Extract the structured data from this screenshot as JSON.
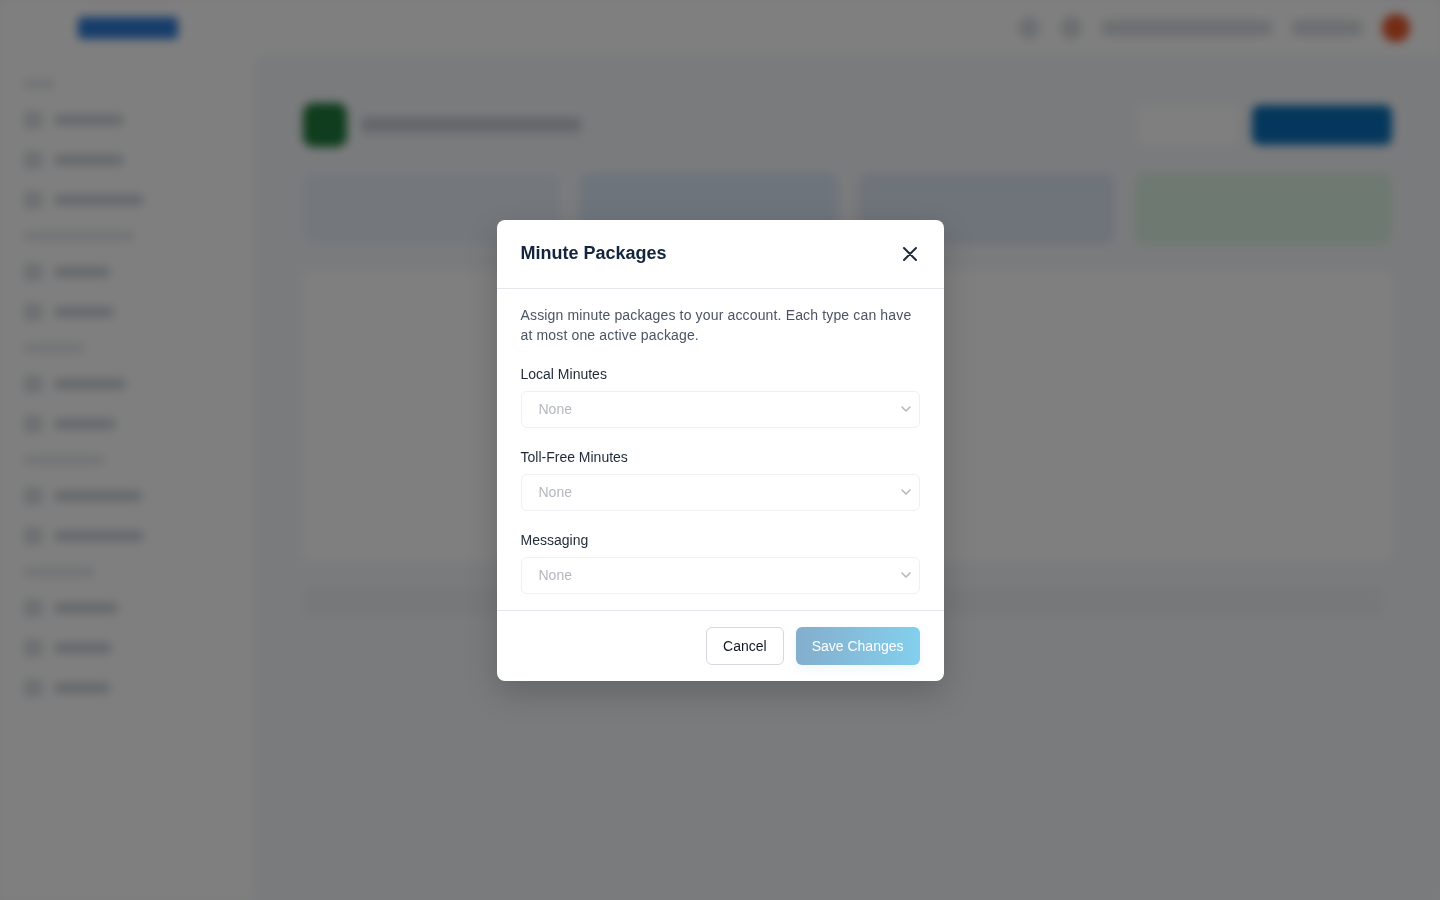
{
  "dialog": {
    "title": "Minute Packages",
    "description": "Assign minute packages to your account. Each type can have at most one active package.",
    "fields": [
      {
        "label": "Local Minutes",
        "value": "None",
        "disabled": true
      },
      {
        "label": "Toll-Free Minutes",
        "value": "None",
        "disabled": true
      },
      {
        "label": "Messaging",
        "value": "None",
        "disabled": true
      }
    ],
    "buttons": [
      {
        "kind": "secondary",
        "label": "Cancel",
        "disabled": false
      },
      {
        "kind": "primary",
        "label": "Save Changes",
        "disabled": true
      }
    ]
  }
}
